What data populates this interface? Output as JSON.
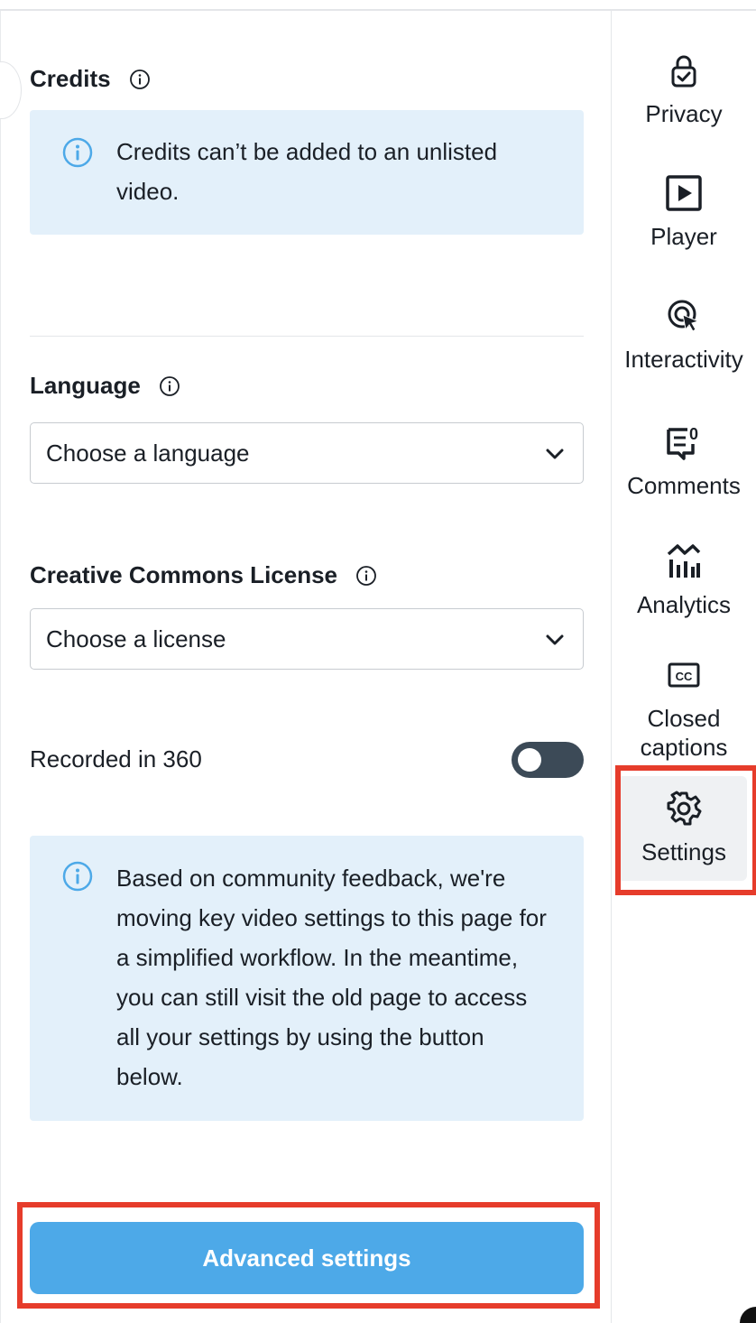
{
  "credits": {
    "title": "Credits",
    "notice": "Credits can’t be added to an unlisted video."
  },
  "language": {
    "title": "Language",
    "placeholder": "Choose a language"
  },
  "license": {
    "title": "Creative Commons License",
    "placeholder": "Choose a license"
  },
  "recorded360": {
    "label": "Recorded in 360",
    "enabled": false
  },
  "settings_notice": {
    "text": "Based on community feedback, we're moving key video settings to this page for a simplified workflow. In the meantime, you can still visit the old page to access all your settings by using the button below."
  },
  "advanced_button": {
    "label": "Advanced settings"
  },
  "sidebar": {
    "items": [
      {
        "label": "Privacy",
        "icon": "lock-icon"
      },
      {
        "label": "Player",
        "icon": "play-icon"
      },
      {
        "label": "Interactivity",
        "icon": "interactivity-icon"
      },
      {
        "label": "Comments",
        "icon": "comments-icon",
        "badge": "0"
      },
      {
        "label": "Analytics",
        "icon": "analytics-icon"
      },
      {
        "label": "Closed captions",
        "icon": "closed-captions-icon"
      },
      {
        "label": "Settings",
        "icon": "gear-icon",
        "active": true
      }
    ]
  },
  "colors": {
    "accent": "#4da9e8",
    "notice_bg": "#e3f0fa",
    "highlight": "#e63c2b",
    "toggle_off": "#3c4a57",
    "info_icon": "#4da9e8"
  }
}
